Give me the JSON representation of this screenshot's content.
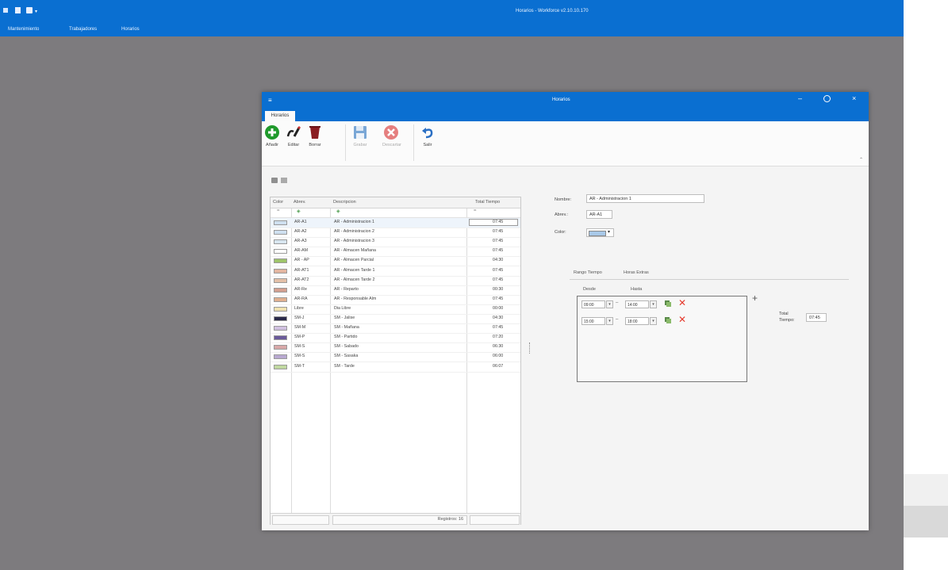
{
  "app": {
    "title": "Horarios - Workforce v2.10.10.170",
    "menu": [
      "Mantenimiento",
      "Trabajadores",
      "Horarios"
    ]
  },
  "dialog": {
    "title": "Horarios",
    "tab": "Horarios",
    "ribbon": {
      "add": "Añadir",
      "edit": "Editar",
      "delete": "Borrar",
      "save": "Grabar",
      "discard": "Descartar",
      "exit": "Salir"
    },
    "grid": {
      "headers": [
        "Color",
        "Abrev.",
        "Descripcion",
        "Total Tiempo"
      ],
      "rows": [
        {
          "color": "#cfe0f0",
          "abbr": "AR-A1",
          "desc": "AR - Administracion 1",
          "total": "07:45"
        },
        {
          "color": "#cfe0f0",
          "abbr": "AR-A2",
          "desc": "AR - Administracion 2",
          "total": "07:45"
        },
        {
          "color": "#d8e6f0",
          "abbr": "AR-A3",
          "desc": "AR - Administracion 3",
          "total": "07:45"
        },
        {
          "color": "#ffffff",
          "abbr": "AR-AM",
          "desc": "AR - Almacen Mañana",
          "total": "07:45"
        },
        {
          "color": "#9ec46a",
          "abbr": "AR - AP",
          "desc": "AR - Almacen Parcial",
          "total": "04:30"
        },
        {
          "color": "#e3b6a0",
          "abbr": "AR-AT1",
          "desc": "AR - Almacen Tarde 1",
          "total": "07:45"
        },
        {
          "color": "#e3c0a8",
          "abbr": "AR-AT2",
          "desc": "AR - Almacen Tarde 2",
          "total": "07:45"
        },
        {
          "color": "#d3a090",
          "abbr": "AR-Re",
          "desc": "AR - Reparto",
          "total": "00:30"
        },
        {
          "color": "#e0b090",
          "abbr": "AR-RA",
          "desc": "AR - Responsable Alm",
          "total": "07:45"
        },
        {
          "color": "#f0e2b0",
          "abbr": "Libre",
          "desc": "Dia Libre",
          "total": "00:00"
        },
        {
          "color": "#2a2a4a",
          "abbr": "SM-J",
          "desc": "SM - Jalise",
          "total": "04:30"
        },
        {
          "color": "#d0c0e0",
          "abbr": "SM-M",
          "desc": "SM - Mañana",
          "total": "07:45"
        },
        {
          "color": "#6a5a9a",
          "abbr": "SM-P",
          "desc": "SM - Partido",
          "total": "07:20"
        },
        {
          "color": "#d8a8a8",
          "abbr": "SM-S",
          "desc": "SM - Sabado",
          "total": "06:30"
        },
        {
          "color": "#b8a8d0",
          "abbr": "SM-S",
          "desc": "SM - Sasaka",
          "total": "06:00"
        },
        {
          "color": "#c0d8a0",
          "abbr": "SM-T",
          "desc": "SM - Tarde",
          "total": "06:07"
        }
      ],
      "footer": "Registros: 16"
    },
    "form": {
      "name_label": "Nombre:",
      "name_value": "AR - Administracion 1",
      "abbr_label": "Abrev.:",
      "abbr_value": "AR-A1",
      "color_label": "Color:",
      "color_value": "#a8c8e8",
      "tabs": [
        "Rango Tiempo",
        "Horas Extras"
      ],
      "from_label": "Desde",
      "to_label": "Hasta",
      "ranges": [
        {
          "from": "09:00",
          "to": "14:00"
        },
        {
          "from": "15:00",
          "to": "18:00"
        }
      ],
      "total_label_1": "Total",
      "total_label_2": "Tiempo:",
      "total_value": "07:45"
    }
  }
}
